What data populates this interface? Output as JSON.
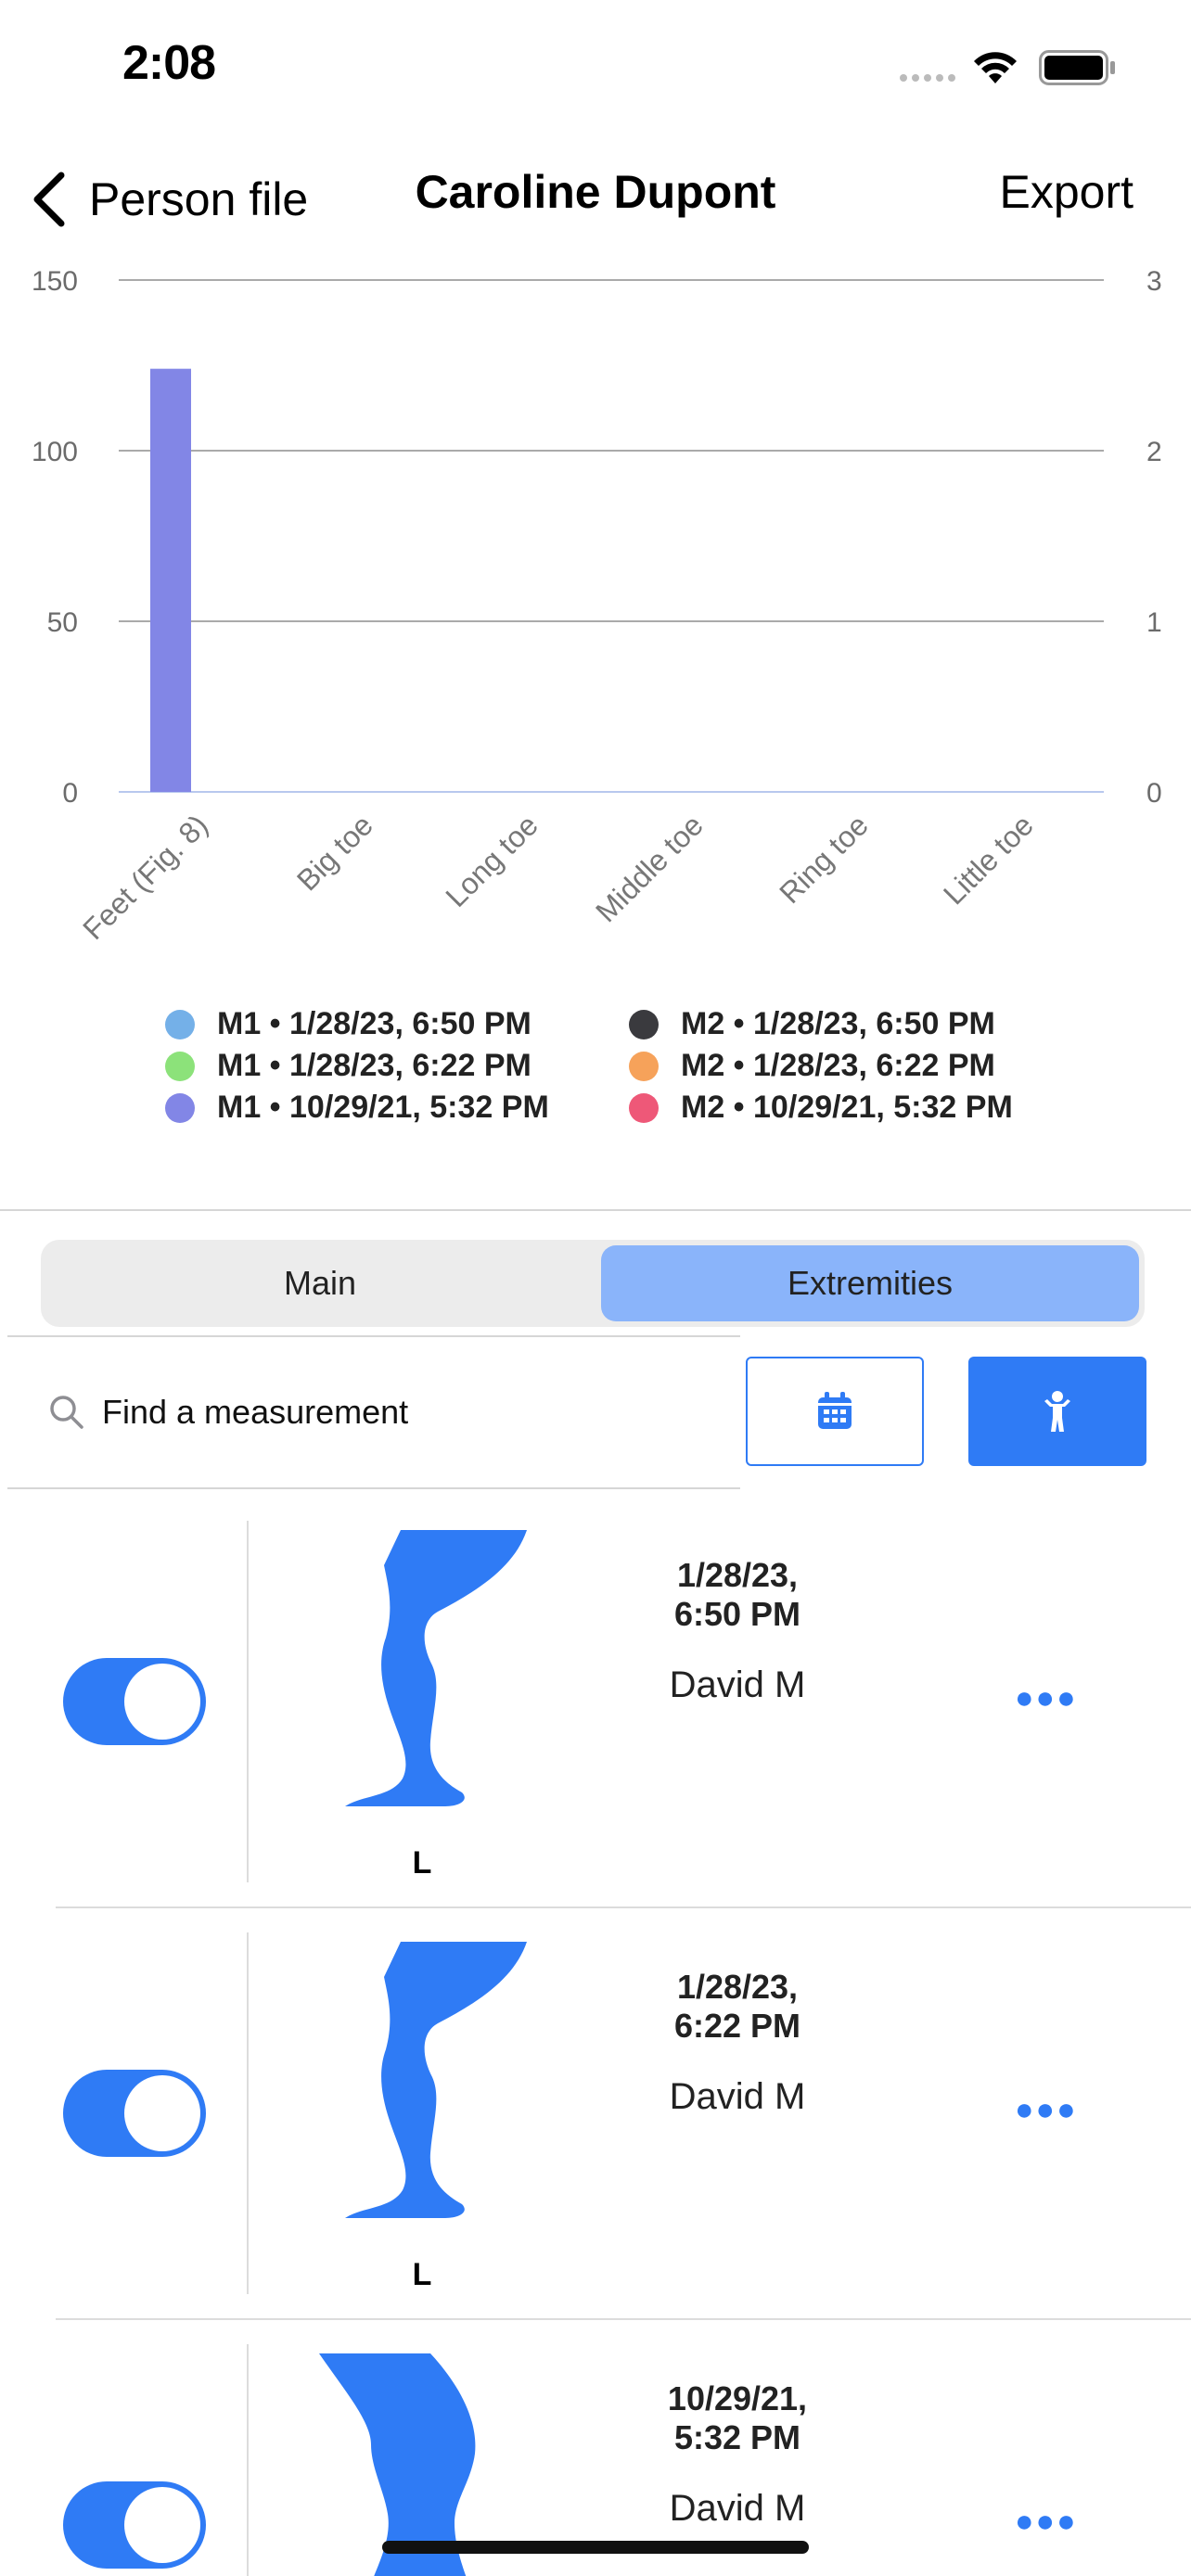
{
  "status_bar": {
    "time": "2:08"
  },
  "nav": {
    "back_label": "Person file",
    "title": "Caroline Dupont",
    "export_label": "Export"
  },
  "chart_data": {
    "type": "bar",
    "categories": [
      "Feet (Fig. 8)",
      "Big toe",
      "Long toe",
      "Middle toe",
      "Ring toe",
      "Little toe"
    ],
    "series": [
      {
        "name": "M1 • 1/28/23, 6:50 PM",
        "color": "#74b0e8",
        "values": [
          0,
          0,
          0,
          0,
          0,
          0
        ]
      },
      {
        "name": "M1 • 1/28/23, 6:22 PM",
        "color": "#8ce27a",
        "values": [
          0,
          0,
          0,
          0,
          0,
          0
        ]
      },
      {
        "name": "M1 • 10/29/21, 5:32 PM",
        "color": "#8286e6",
        "values": [
          124,
          0,
          0,
          0,
          0,
          0
        ]
      },
      {
        "name": "M2 • 1/28/23, 6:50 PM",
        "color": "#3a3a3e",
        "values": [
          0,
          0,
          0,
          0,
          0,
          0
        ]
      },
      {
        "name": "M2 • 1/28/23, 6:22 PM",
        "color": "#f6a25a",
        "values": [
          0,
          0,
          0,
          0,
          0,
          0
        ]
      },
      {
        "name": "M2 • 10/29/21, 5:32 PM",
        "color": "#ee5878",
        "values": [
          0,
          0,
          0,
          0,
          0,
          0
        ]
      }
    ],
    "y_left_ticks": [
      "0",
      "50",
      "100",
      "150"
    ],
    "y_right_ticks": [
      "0",
      "1",
      "2",
      "3"
    ],
    "ylim": [
      0,
      150
    ],
    "ylim_right": [
      0,
      3
    ],
    "grid": true,
    "legend_position": "bottom"
  },
  "segmented": {
    "main_label": "Main",
    "extremities_label": "Extremities",
    "selected": "Extremities"
  },
  "search": {
    "placeholder": "Find a measurement",
    "calendar_icon": "calendar-icon",
    "body_icon": "person-icon"
  },
  "colors": {
    "accent": "#2f7bf5",
    "segment_selected": "#8ab4fa"
  },
  "measurements": [
    {
      "date": "1/28/23,\n6:50 PM",
      "user": "David M",
      "side": "L",
      "enabled": true
    },
    {
      "date": "1/28/23,\n6:22 PM",
      "user": "David M",
      "side": "L",
      "enabled": true
    },
    {
      "date": "10/29/21,\n5:32 PM",
      "user": "David M",
      "side": "",
      "enabled": true
    }
  ]
}
